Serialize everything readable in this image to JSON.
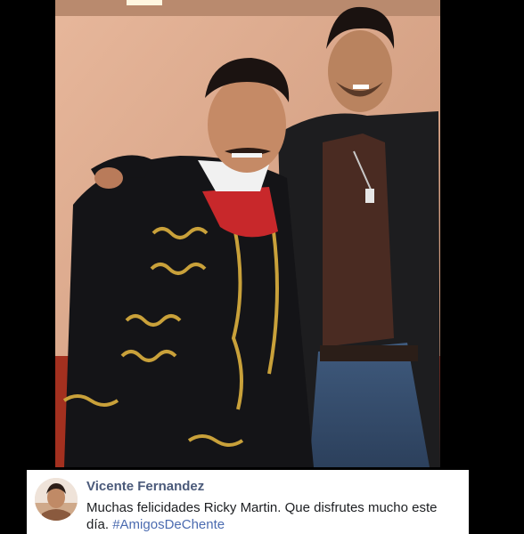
{
  "photo": {
    "description_icon": "photo-image"
  },
  "post": {
    "author": "Vicente Fernandez",
    "message": "Muchas felicidades Ricky Martin. Que disfrutes mucho este día.",
    "hashtag": "#AmigosDeChente",
    "avatar_icon": "profile-avatar"
  },
  "colors": {
    "author": "#4b5a7a",
    "hashtag": "#4b6bb0",
    "wall": "#d9a98d",
    "scarf": "#c8282b"
  }
}
